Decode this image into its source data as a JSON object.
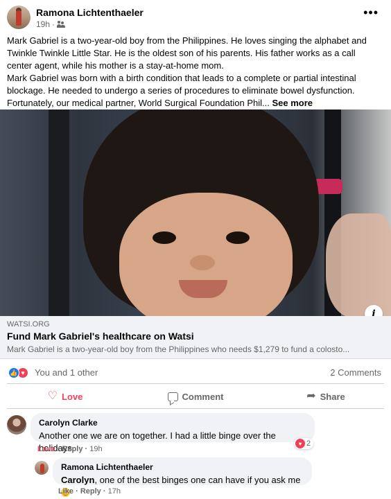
{
  "post": {
    "author": "Ramona Lichtenthaeler",
    "time": "19h",
    "audience_icon": "friends-icon",
    "more_label": "•••",
    "text_p1": "Mark Gabriel is a two-year-old boy from the Philippines. He loves singing the alphabet and Twinkle Twinkle Little Star. He is the oldest son of his parents. His father works as a call center agent, while his mother is a stay-at-home mom.",
    "text_p2": "Mark Gabriel was born with a birth condition that leads to a complete or partial intestinal blockage. He needed to undergo a series of procedures to eliminate bowel dysfunction. Fortunately, our medical partner, World Surgical Foundation Phil...",
    "see_more": "See more"
  },
  "link_preview": {
    "domain": "WATSI.ORG",
    "title": "Fund Mark Gabriel's healthcare on Watsi",
    "description": "Mark Gabriel is a two-year-old boy from the Philippines who needs $1,279 to fund a colosto...",
    "info_label": "i"
  },
  "reactions": {
    "summary": "You and 1 other",
    "comments_count": "2 Comments",
    "icons": [
      "like-icon",
      "love-icon"
    ]
  },
  "actions": {
    "love": "Love",
    "comment": "Comment",
    "share": "Share"
  },
  "comments": [
    {
      "name": "Carolyn Clarke",
      "text": "Another one we are on together. I had a little binge over the holidays.",
      "love_label": "Love",
      "reply_label": "Reply",
      "time": "19h",
      "reaction_count": "2"
    },
    {
      "name": "Ramona Lichtenthaeler",
      "mention": "Carolyn",
      "text": ", one of the best binges one can have if you ask me",
      "like_label": "Like",
      "reply_label": "Reply",
      "time": "17h"
    }
  ],
  "colors": {
    "accent_love": "#f33e58",
    "accent_like": "#1877f2",
    "muted_text": "#65676b"
  }
}
